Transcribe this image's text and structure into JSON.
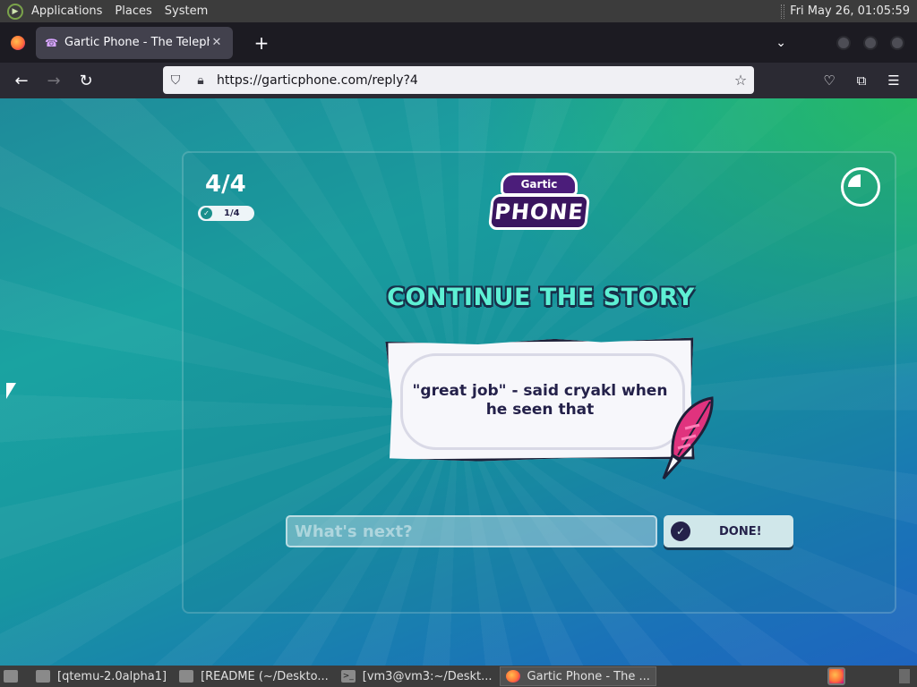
{
  "top_panel": {
    "menus": [
      "Applications",
      "Places",
      "System"
    ],
    "clock": "Fri May 26, 01:05:59"
  },
  "browser": {
    "tab_title": "Gartic Phone - The Telephone",
    "url": "https://garticphone.com/reply?4"
  },
  "game": {
    "round_counter": "4/4",
    "done_count": "1/4",
    "logo_top": "Gartic",
    "logo_word": "PHONE",
    "title": "CONTINUE THE STORY",
    "prompt": "\"great job\" - said cryakl when he seen that",
    "input_placeholder": "What's next?",
    "done_button": "DONE!",
    "timer_remaining_fraction": 0.75,
    "accent_color": "#5ef0d4"
  },
  "taskbar": {
    "tasks": [
      {
        "label": "[qtemu-2.0alpha1]",
        "icon": "folder-icon"
      },
      {
        "label": "[README (~/Deskto...",
        "icon": "text-editor-icon"
      },
      {
        "label": "[vm3@vm3:~/Deskt...",
        "icon": "terminal-icon"
      },
      {
        "label": "Gartic Phone - The ...",
        "icon": "firefox-icon"
      }
    ]
  }
}
